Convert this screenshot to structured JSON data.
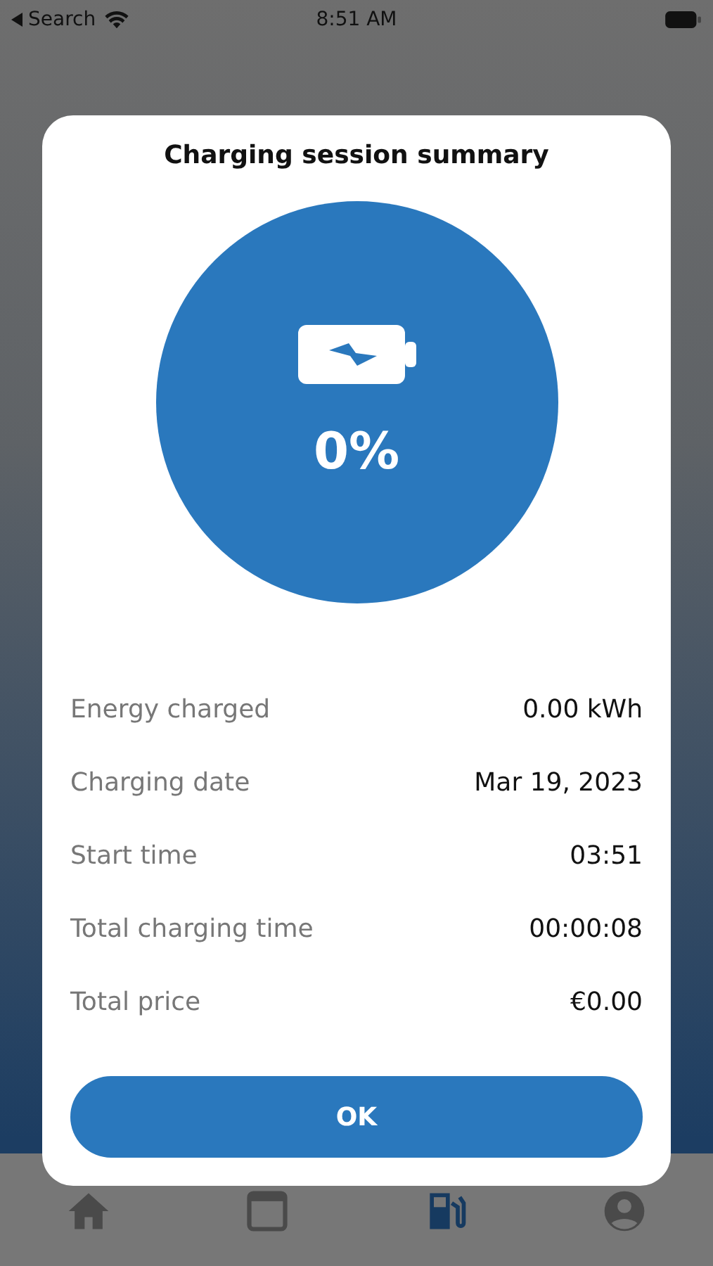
{
  "status_bar": {
    "back_label": "Search",
    "time": "8:51 AM"
  },
  "dialog": {
    "title": "Charging session summary",
    "percent": "0%",
    "rows": [
      {
        "label": "Energy charged",
        "value": "0.00 kWh"
      },
      {
        "label": "Charging date",
        "value": "Mar 19, 2023"
      },
      {
        "label": "Start time",
        "value": "03:51"
      },
      {
        "label": "Total charging time",
        "value": "00:00:08"
      },
      {
        "label": "Total price",
        "value": "€0.00"
      }
    ],
    "button": "OK"
  },
  "tab_bar": [
    {
      "kind": "home",
      "selected": false
    },
    {
      "kind": "calendar",
      "selected": false
    },
    {
      "kind": "fuel",
      "selected": true
    },
    {
      "kind": "account",
      "selected": false
    }
  ]
}
